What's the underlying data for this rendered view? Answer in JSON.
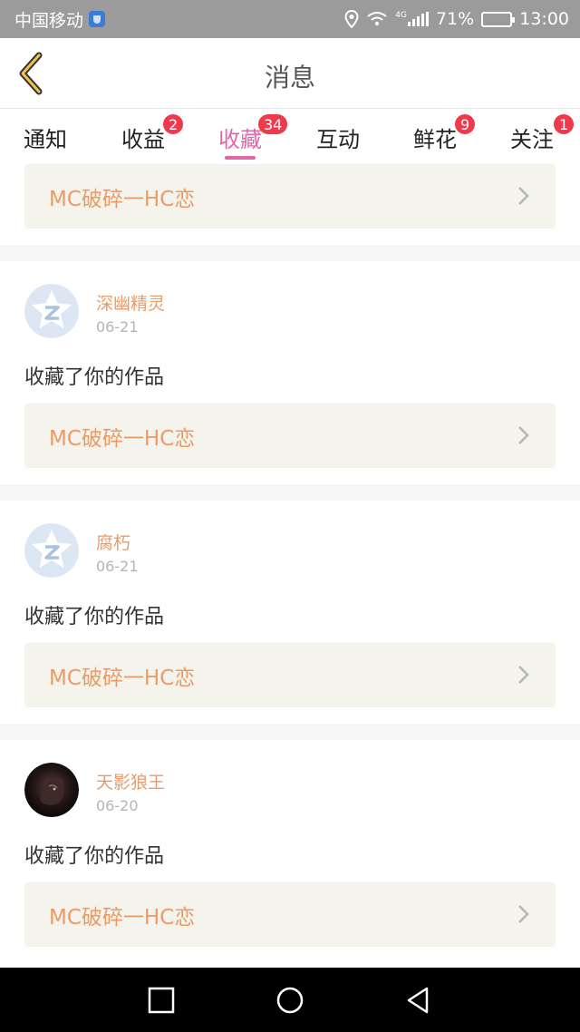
{
  "status_bar": {
    "carrier": "中国移动",
    "network": "4G",
    "battery": "71%",
    "battery_level": 0.71,
    "time": "13:00",
    "icons": [
      "shield-icon",
      "location-icon",
      "wifi-icon",
      "signal-icon",
      "battery-icon"
    ]
  },
  "header": {
    "title": "消息",
    "back_icon": "chevron-left-icon"
  },
  "tabs": [
    {
      "label": "通知",
      "badge": ""
    },
    {
      "label": "收益",
      "badge": "2"
    },
    {
      "label": "收藏",
      "badge": "34",
      "active": true
    },
    {
      "label": "互动",
      "badge": ""
    },
    {
      "label": "鲜花",
      "badge": "9"
    },
    {
      "label": "关注",
      "badge": "1"
    }
  ],
  "feed": {
    "partial_item": {
      "work_title": "MC破碎一HC恋"
    },
    "items": [
      {
        "username": "深幽精灵",
        "date": "06-21",
        "action": "收藏了你的作品",
        "work_title": "MC破碎一HC恋",
        "avatar": "default-star-avatar"
      },
      {
        "username": "腐朽",
        "date": "06-21",
        "action": "收藏了你的作品",
        "work_title": "MC破碎一HC恋",
        "avatar": "default-star-avatar"
      },
      {
        "username": "天影狼王",
        "date": "06-20",
        "action": "收藏了你的作品",
        "work_title": "MC破碎一HC恋",
        "avatar": "dark-wolf-avatar"
      }
    ]
  },
  "colors": {
    "accent_pink": "#e067a8",
    "name_orange": "#ea9b67",
    "badge_red": "#f0394a",
    "link_bg": "#f4f3ec"
  },
  "navbar": {
    "icons": [
      "recent-apps-icon",
      "home-icon",
      "back-icon"
    ]
  }
}
